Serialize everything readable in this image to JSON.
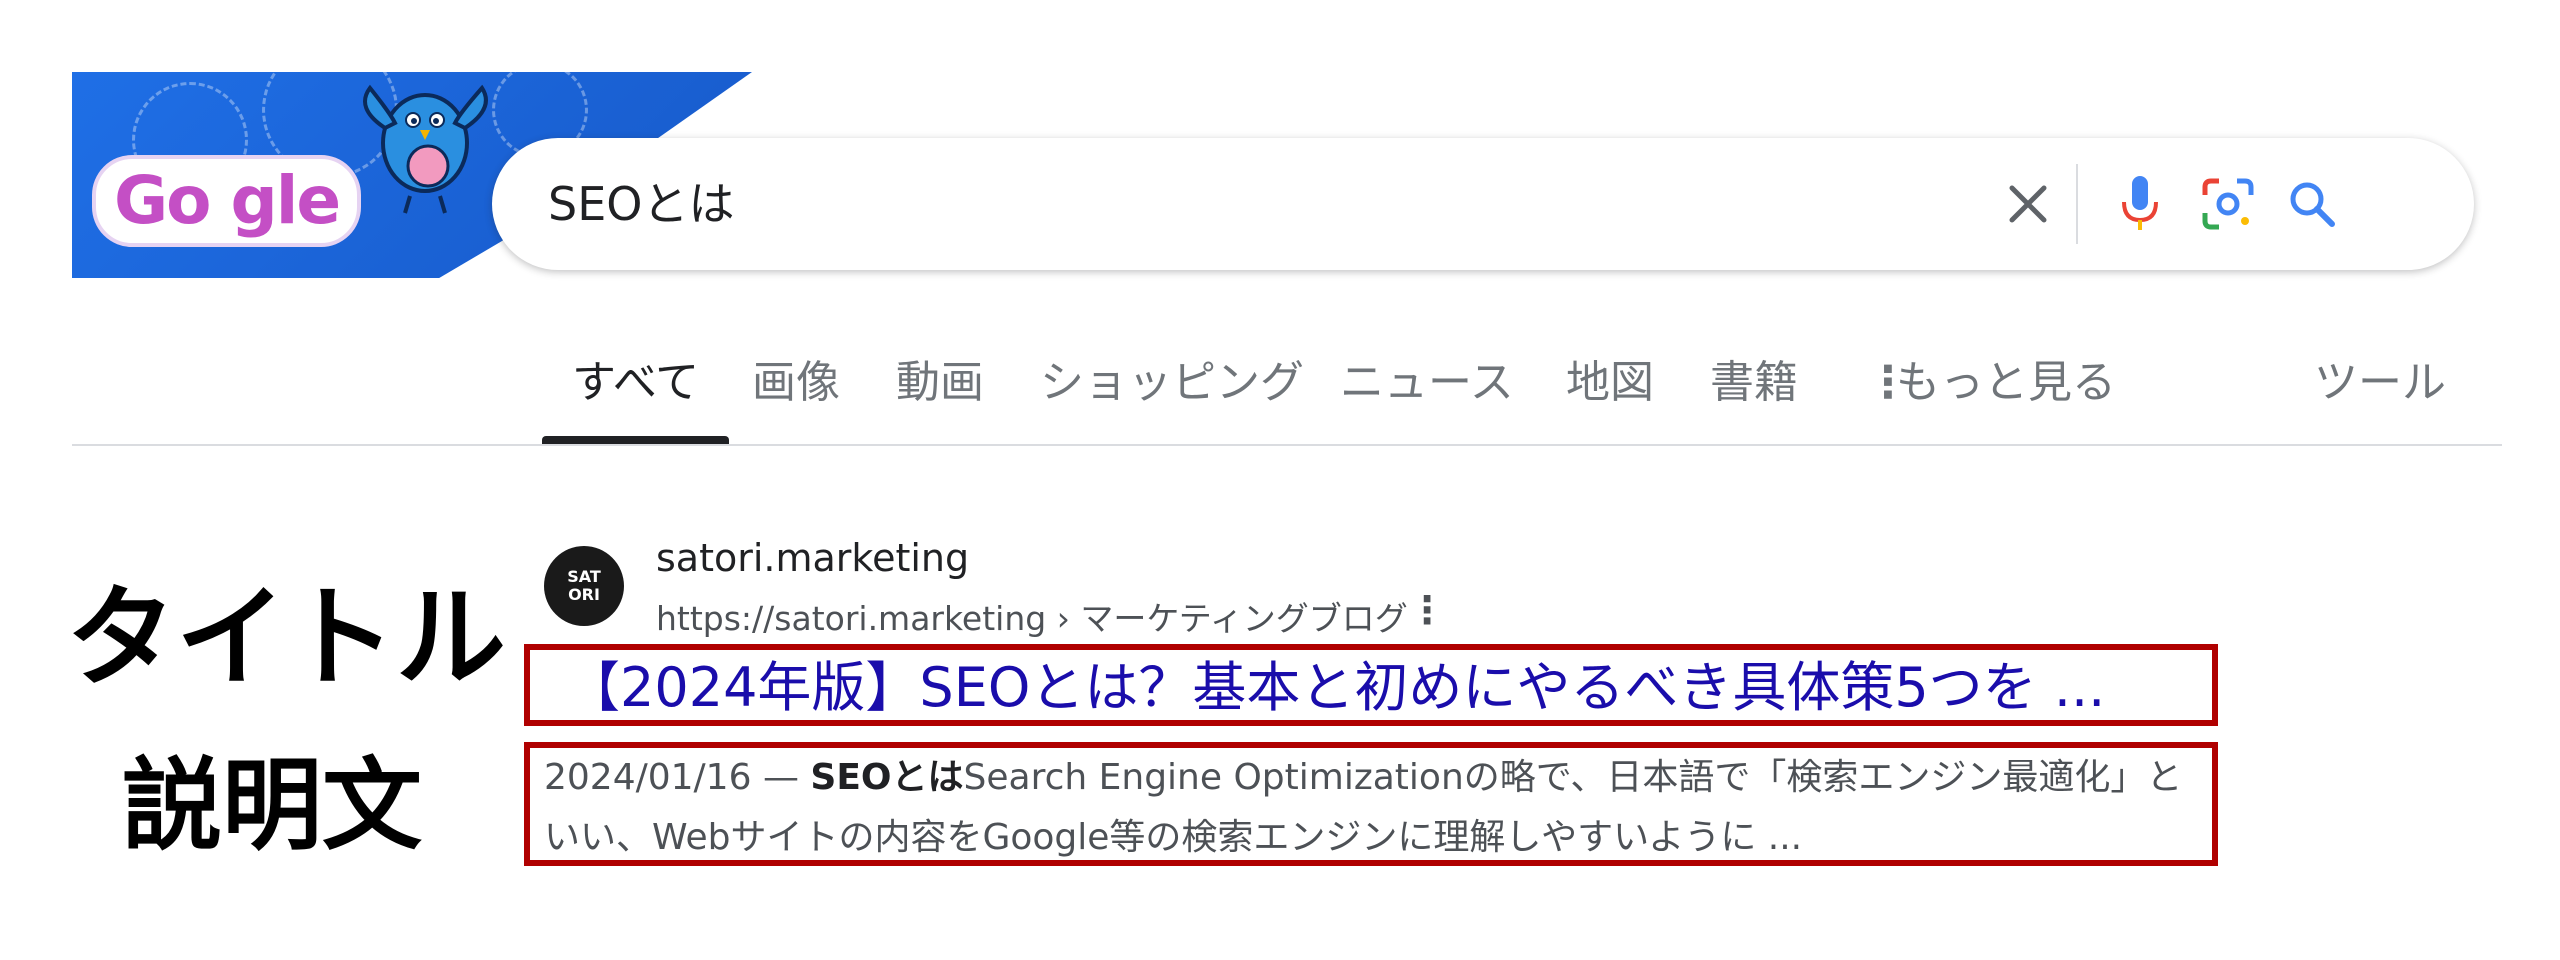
{
  "doodle": {
    "logo_text": "Go gle"
  },
  "search": {
    "query": "SEOとは",
    "colors": {
      "mic_blue": "#4285f4",
      "mic_red": "#ea4335",
      "lens": "#4285f4",
      "search_blue": "#4285f4"
    }
  },
  "tabs": [
    {
      "label": "すべて",
      "active": true
    },
    {
      "label": "画像"
    },
    {
      "label": "動画"
    },
    {
      "label": "ショッピング"
    },
    {
      "label": "ニュース"
    },
    {
      "label": "地図"
    },
    {
      "label": "書籍"
    },
    {
      "label": "もっと見る"
    },
    {
      "label": "ツール"
    }
  ],
  "annotations": {
    "title_label": "タイトル",
    "desc_label": "説明文"
  },
  "result": {
    "site_icon_text": "SATORI",
    "site_name": "satori.marketing",
    "url_host": "https://satori.marketing",
    "url_sep": " › ",
    "url_path": "マーケティングブログ",
    "title": "【2024年版】SEOとは？基本と初めにやるべき具体策5つを ...",
    "date": "2024/01/16",
    "dash": " — ",
    "desc_bold": "SEOとは",
    "desc_rest": "Search Engine Optimizationの略で、日本語で「検索エンジン最適化」といい、Webサイトの内容をGoogle等の検索エンジンに理解しやすいように ..."
  },
  "colors": {
    "accent_red": "#b00000",
    "link_blue": "#1a0dab",
    "doodle_blue": "#1f6fe6"
  }
}
